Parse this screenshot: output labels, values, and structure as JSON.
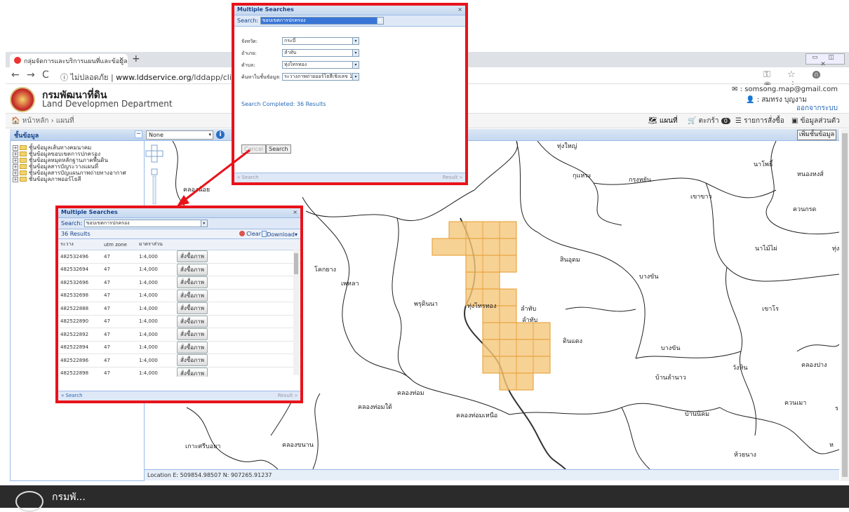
{
  "browser": {
    "tab_title": "กลุ่มจัดการและบริการแผนที่และข้อมูล",
    "tab_close": "×",
    "new_tab": "+",
    "window_buttons": "▭ ◫ ✕",
    "back": "←",
    "forward": "→",
    "reload": "C",
    "security": "ⓘ ไม่ปลอดภัย |",
    "url_domain": "www.lddservice.org",
    "url_path": "/lddapp/client/#/map",
    "ext_icons": "⚿ ☆ ⓿ ◉ ⋮"
  },
  "site": {
    "title_th": "กรมพัฒนาที่ดิน",
    "title_en": "Land Developmen Department",
    "email": "✉ : somsong.map@gmail.com",
    "user": "👤 : สมทรง บุญงาม",
    "logout": "ออกจากระบบ",
    "breadcrumb": "🏠 หน้าหลัก  ›  แผนที่",
    "nav": {
      "map": "🗺 แผนที่",
      "cart": "🛒 ตะกร้า",
      "cart_count": "0",
      "orders": "☰ รายการสั่งซื้อ",
      "profile": "▣ ข้อมูลส่วนตัว"
    }
  },
  "layers": {
    "header": "ชั้นข้อมูล",
    "collapse": "−",
    "items": [
      "ชั้นข้อมูลเส้นทางคมนาคม",
      "ชั้นข้อมูลขอบเขตการปกครอง",
      "ชั้นข้อมูลหมุดหลักฐานภาคพื้นดิน",
      "ชั้นข้อมูลสารบัญระวางแผนที่",
      "ชั้นข้อมูลสารบัญแผนภาพถ่ายทางอากาศ",
      "ชั้นข้อมูลภาพออร์โธสี"
    ]
  },
  "map": {
    "base_layer": "None",
    "info": "i",
    "add_layer": "เพิ่มชั้นข้อมูล",
    "status": "Location   E: 509854.98507    N: 907265.91237",
    "labels": [
      {
        "text": "ทุ่งใหญ่"
      },
      {
        "text": "นาโพธิ์"
      },
      {
        "text": "หนองหงส์"
      },
      {
        "text": "กุแหระ"
      },
      {
        "text": "กรุงหยัน"
      },
      {
        "text": "เขาขาว"
      },
      {
        "text": "ควนกรด"
      },
      {
        "text": "นาไม้ไผ่"
      },
      {
        "text": "ทุ่งส"
      },
      {
        "text": "คลองน้อย"
      },
      {
        "text": "รร"
      },
      {
        "text": "สินอุดม"
      },
      {
        "text": "โคกยาง"
      },
      {
        "text": "เพหลา"
      },
      {
        "text": "พรุดินนา"
      },
      {
        "text": "บางขัน"
      },
      {
        "text": "เขาโร"
      },
      {
        "text": "ทุ่งไทรทอง"
      },
      {
        "text": "ลำทับ"
      },
      {
        "text": "ลำทับ"
      },
      {
        "text": "ดินแดง"
      },
      {
        "text": "บางขัน"
      },
      {
        "text": "วังหิน"
      },
      {
        "text": "คลองปาง"
      },
      {
        "text": "บ้านลำนาว"
      },
      {
        "text": "คลองท่อม"
      },
      {
        "text": "คลองท่อมใต้"
      },
      {
        "text": "คลองท่อมเหนือ"
      },
      {
        "text": "ควนเมา"
      },
      {
        "text": "ร"
      },
      {
        "text": "บ้านนิคม"
      },
      {
        "text": "เกาะศรีบอยา"
      },
      {
        "text": "คลองขนาน"
      },
      {
        "text": "ห้วยนาง"
      },
      {
        "text": "ห"
      }
    ]
  },
  "search_panel": {
    "title": "Multiple Searches",
    "close": "×",
    "search_label": "Search:",
    "search_value": "ขอบเขตการปกครอง",
    "fields": [
      {
        "label": "จังหวัด:",
        "value": "กระบี่"
      },
      {
        "label": "อำเภอ:",
        "value": "ลำทับ"
      },
      {
        "label": "ตำบล:",
        "value": "ทุ่งไทรทอง"
      },
      {
        "label": "ค้นหาในชั้นข้อมูล:",
        "value": "ระวางภาพถ่ายออร์โธสีเชิงเลข 1:4"
      }
    ],
    "status": "Search Completed: 36 Results",
    "cancel": "Cancel",
    "search_btn": "Search",
    "footer_left": "« Search",
    "footer_right": "Result »"
  },
  "results_panel": {
    "title": "Multiple Searches",
    "close": "×",
    "search_label": "Search:",
    "search_value": "ขอบเขตการปกครอง",
    "count": "36 Results",
    "clear": "Clear",
    "download": "Download▾",
    "columns": [
      "ระวาง",
      "utm zone",
      "มาตราส่วน"
    ],
    "order_label": "สั่งซื้อภาพ",
    "rows": [
      {
        "sheet": "482532496",
        "zone": "47",
        "scale": "1:4,000"
      },
      {
        "sheet": "482532694",
        "zone": "47",
        "scale": "1:4,000"
      },
      {
        "sheet": "482532696",
        "zone": "47",
        "scale": "1:4,000"
      },
      {
        "sheet": "482532698",
        "zone": "47",
        "scale": "1:4,000"
      },
      {
        "sheet": "482522888",
        "zone": "47",
        "scale": "1:4,000"
      },
      {
        "sheet": "482522890",
        "zone": "47",
        "scale": "1:4,000"
      },
      {
        "sheet": "482522892",
        "zone": "47",
        "scale": "1:4,000"
      },
      {
        "sheet": "482522894",
        "zone": "47",
        "scale": "1:4,000"
      },
      {
        "sheet": "482522896",
        "zone": "47",
        "scale": "1:4,000"
      },
      {
        "sheet": "482522898",
        "zone": "47",
        "scale": "1:4,000"
      }
    ],
    "footer_left": "« Search",
    "footer_right": "Result »"
  },
  "footer": {
    "text": "กรมพั..."
  },
  "colors": {
    "highlight": "#e8131a",
    "grid_fill": "#f5c77a",
    "grid_stroke": "#e49b2d",
    "panel_header": "#15428b"
  }
}
